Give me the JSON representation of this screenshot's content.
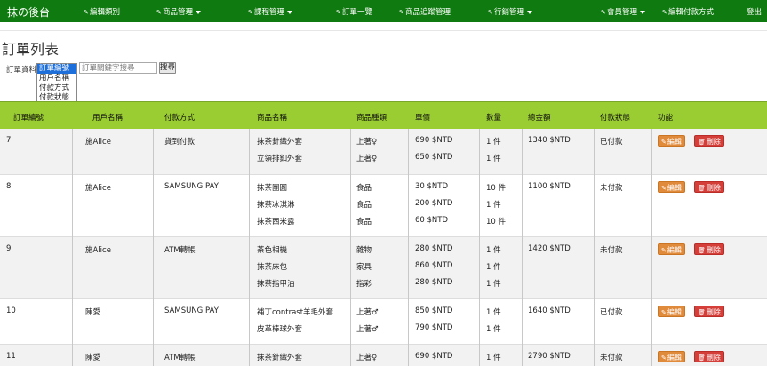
{
  "nav": {
    "brand": "抹の後台",
    "items": [
      {
        "label": "編輯類別",
        "icon": "pencil-icon",
        "dropdown": false
      },
      {
        "label": "商品管理",
        "icon": "pencil-icon",
        "dropdown": true
      },
      {
        "label": "課程管理",
        "icon": "pencil-icon",
        "dropdown": true
      },
      {
        "label": "訂單一覽",
        "icon": "pencil-icon",
        "dropdown": false
      },
      {
        "label": "商品追蹤管理",
        "icon": "pencil-icon",
        "dropdown": false
      },
      {
        "label": "行銷管理",
        "icon": "pencil-icon",
        "dropdown": true
      },
      {
        "label": "會員管理",
        "icon": "pencil-icon",
        "dropdown": true
      },
      {
        "label": "編輯付款方式",
        "icon": "pencil-icon",
        "dropdown": false
      }
    ],
    "logout": "登出",
    "color": "#0f7a0f"
  },
  "page_title": "訂單列表",
  "search": {
    "label": "訂單資料",
    "options": [
      "訂單編號",
      "用戶名稱",
      "付款方式",
      "付款狀態"
    ],
    "selected": "訂單編號",
    "placeholder": "訂單關鍵字搜尋",
    "button": "搜尋"
  },
  "table": {
    "header_color": "#9acd32",
    "columns": [
      "訂單編號",
      "用戶名稱",
      "付款方式",
      "商品名稱",
      "商品種類",
      "單價",
      "數量",
      "總金額",
      "付款狀態",
      "功能"
    ],
    "edit_label": "編輯",
    "delete_label": "刪除",
    "rows": [
      {
        "id": "7",
        "user": "施Alice",
        "payment": "貨到付款",
        "total": "1340 $NTD",
        "status": "已付款",
        "items": [
          {
            "name": "抹茶針織外套",
            "type": "上著♀",
            "price": "690 $NTD",
            "qty": "1 件"
          },
          {
            "name": "立領排釦外套",
            "type": "上著♀",
            "price": "650 $NTD",
            "qty": "1 件"
          }
        ]
      },
      {
        "id": "8",
        "user": "施Alice",
        "payment": "SAMSUNG PAY",
        "total": "1100 $NTD",
        "status": "未付款",
        "items": [
          {
            "name": "抹茶團圓",
            "type": "食品",
            "price": "30 $NTD",
            "qty": "10 件"
          },
          {
            "name": "抹茶冰淇淋",
            "type": "食品",
            "price": "200 $NTD",
            "qty": "1 件"
          },
          {
            "name": "抹茶西米露",
            "type": "食品",
            "price": "60 $NTD",
            "qty": "10 件"
          }
        ]
      },
      {
        "id": "9",
        "user": "施Alice",
        "payment": "ATM轉帳",
        "total": "1420 $NTD",
        "status": "未付款",
        "items": [
          {
            "name": "茶色相機",
            "type": "雜物",
            "price": "280 $NTD",
            "qty": "1 件"
          },
          {
            "name": "抹茶床包",
            "type": "家具",
            "price": "860 $NTD",
            "qty": "1 件"
          },
          {
            "name": "抹茶指甲油",
            "type": "指彩",
            "price": "280 $NTD",
            "qty": "1 件"
          }
        ]
      },
      {
        "id": "10",
        "user": "陳愛",
        "payment": "SAMSUNG PAY",
        "total": "1640 $NTD",
        "status": "已付款",
        "items": [
          {
            "name": "補丁contrast羊毛外套",
            "type": "上著♂",
            "price": "850 $NTD",
            "qty": "1 件"
          },
          {
            "name": "皮革棒球外套",
            "type": "上著♂",
            "price": "790 $NTD",
            "qty": "1 件"
          }
        ]
      },
      {
        "id": "11",
        "user": "陳愛",
        "payment": "ATM轉帳",
        "total": "2790 $NTD",
        "status": "未付款",
        "items": [
          {
            "name": "抹茶針織外套",
            "type": "上著♀",
            "price": "690 $NTD",
            "qty": "1 件"
          }
        ]
      }
    ]
  }
}
